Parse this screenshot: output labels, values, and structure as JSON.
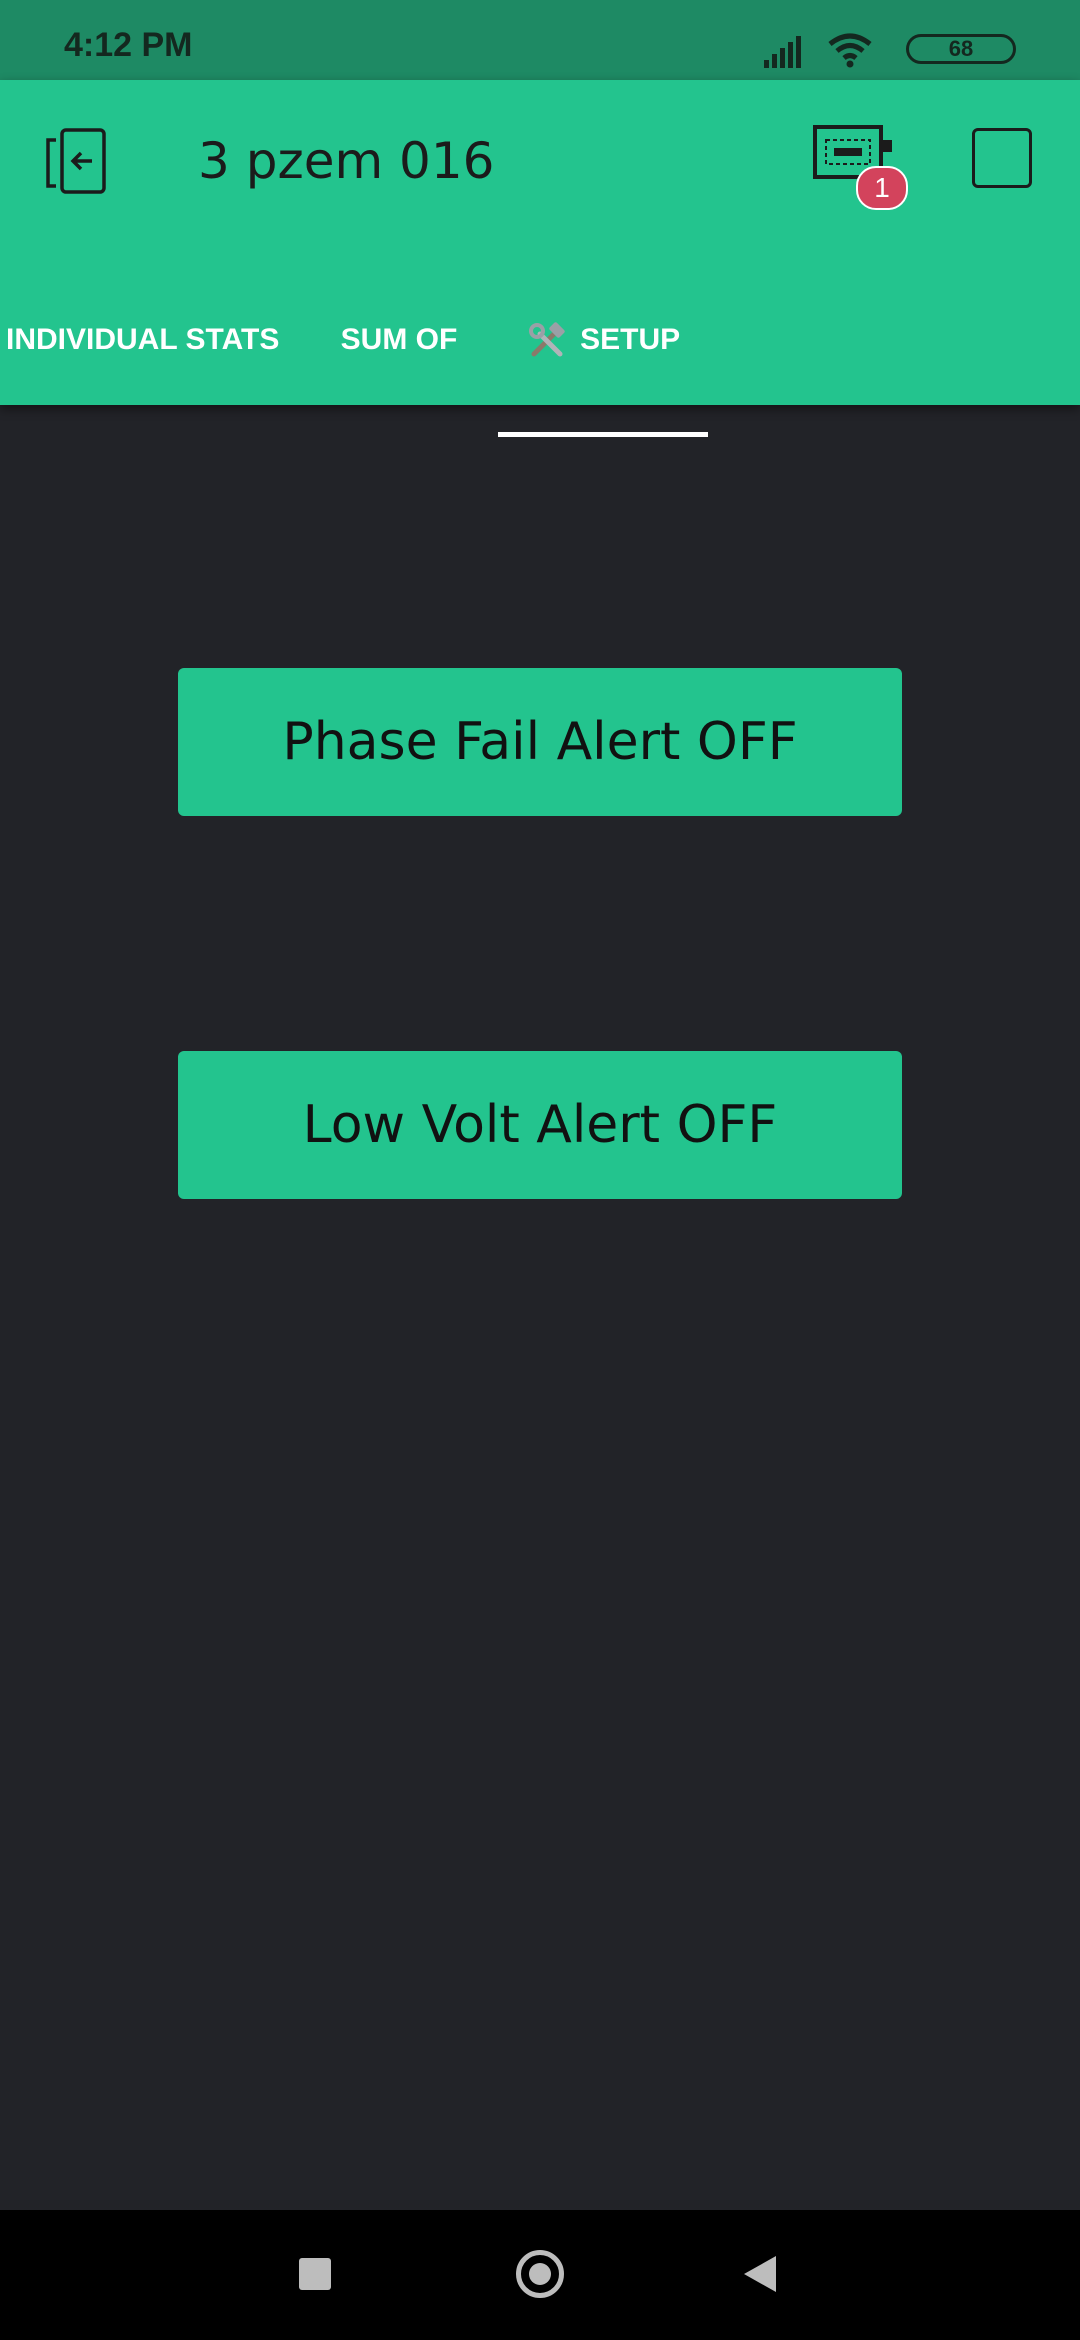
{
  "status_bar": {
    "time": "4:12 PM",
    "battery": "68",
    "icons": [
      "signal-icon",
      "wifi-icon",
      "battery-icon"
    ]
  },
  "header": {
    "title": "3 pzem 016",
    "device_badge_count": "1",
    "icons": [
      "back-icon",
      "device-icon",
      "fullscreen-icon"
    ]
  },
  "tabs": [
    {
      "label": "INDIVIDUAL STATS",
      "active": false
    },
    {
      "label": "SUM OF",
      "active": false
    },
    {
      "label": "SETUP",
      "active": true,
      "icon": "tools-icon"
    }
  ],
  "buttons": {
    "phase_fail": "Phase Fail Alert OFF",
    "low_volt": "Low Volt Alert OFF"
  },
  "colors": {
    "accent": "#23c48e",
    "status_bar": "#1e8a64",
    "background": "#222328",
    "badge": "#d3435c"
  },
  "nav_bar": {
    "icons": [
      "recents-icon",
      "home-icon",
      "back-nav-icon"
    ]
  }
}
